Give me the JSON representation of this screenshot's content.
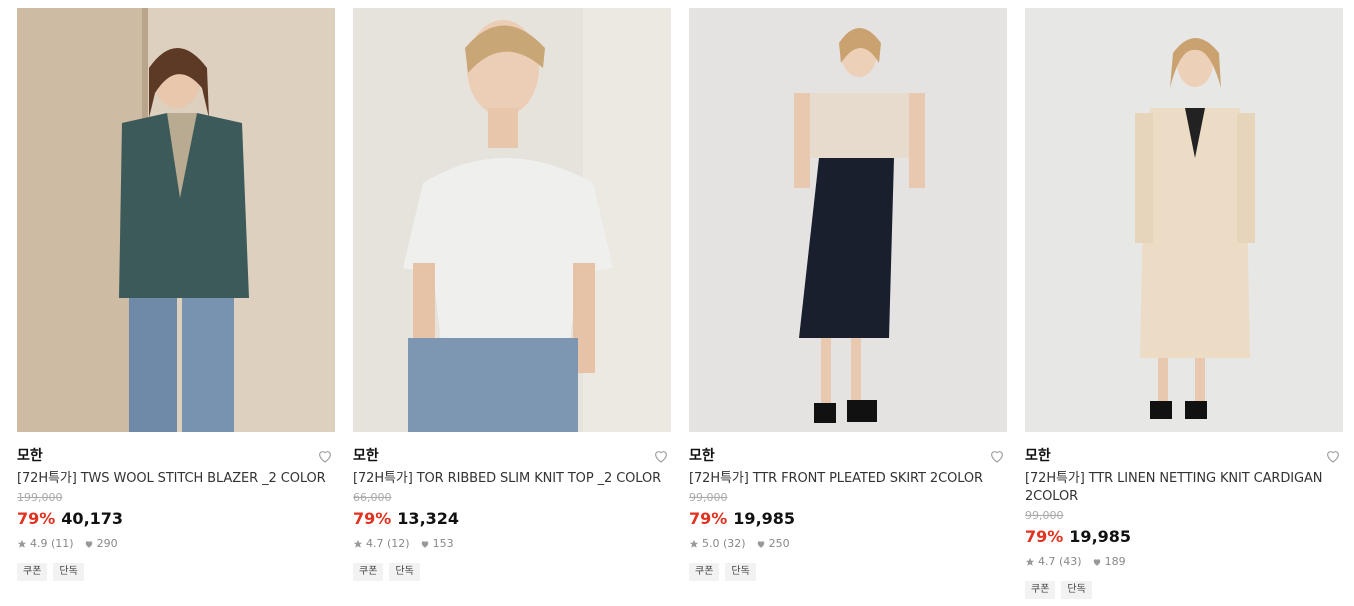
{
  "products": [
    {
      "brand": "모한",
      "title": "[72H특가] TWS WOOL STITCH BLAZER _2 COLOR",
      "original_price": "199,000",
      "discount": "79%",
      "price": "40,173",
      "rating": "4.9",
      "reviews": "(11)",
      "likes": "290",
      "tags": [
        "쿠폰",
        "단독"
      ],
      "image_desc": "woman in teal blazer and jeans"
    },
    {
      "brand": "모한",
      "title": "[72H특가] TOR RIBBED SLIM KNIT TOP _2 COLOR",
      "original_price": "66,000",
      "discount": "79%",
      "price": "13,324",
      "rating": "4.7",
      "reviews": "(12)",
      "likes": "153",
      "tags": [
        "쿠폰",
        "단독"
      ],
      "image_desc": "woman in white ribbed knit top"
    },
    {
      "brand": "모한",
      "title": "[72H특가] TTR FRONT PLEATED SKIRT 2COLOR",
      "original_price": "99,000",
      "discount": "79%",
      "price": "19,985",
      "rating": "5.0",
      "reviews": "(32)",
      "likes": "250",
      "tags": [
        "쿠폰",
        "단독"
      ],
      "image_desc": "woman in navy pleated skirt"
    },
    {
      "brand": "모한",
      "title": "[72H특가] TTR LINEN NETTING KNIT CARDIGAN 2COLOR",
      "original_price": "99,000",
      "discount": "79%",
      "price": "19,985",
      "rating": "4.7",
      "reviews": "(43)",
      "likes": "189",
      "tags": [
        "쿠폰",
        "단독"
      ],
      "image_desc": "woman in beige netting cardigan"
    }
  ],
  "colors": {
    "discount": "#e2311e"
  }
}
